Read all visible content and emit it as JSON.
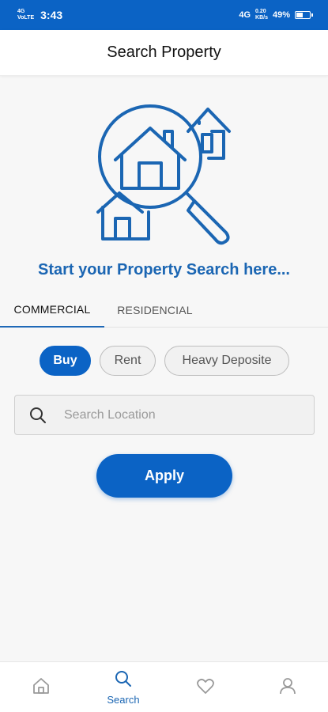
{
  "status_bar": {
    "network": "4G\nVoLTE",
    "time": "3:43",
    "signal_text": "4G",
    "speed": "0.20\nKB/s",
    "battery_percent": "49%",
    "battery_level": 0.49
  },
  "header": {
    "title": "Search Property"
  },
  "illustration": {
    "icon": "house-search-magnifier-icon",
    "color": "#1b66b3"
  },
  "headline": "Start your Property Search here...",
  "tabs": [
    {
      "label": "COMMERCIAL",
      "active": true
    },
    {
      "label": "RESIDENCIAL",
      "active": false
    }
  ],
  "chips": [
    {
      "label": "Buy",
      "active": true
    },
    {
      "label": "Rent",
      "active": false
    },
    {
      "label": "Heavy Deposite",
      "active": false
    }
  ],
  "search": {
    "placeholder": "Search Location",
    "value": ""
  },
  "apply_label": "Apply",
  "bottom_nav": [
    {
      "icon": "home-icon",
      "label": "",
      "active": false
    },
    {
      "icon": "search-icon",
      "label": "Search",
      "active": true
    },
    {
      "icon": "heart-icon",
      "label": "",
      "active": false
    },
    {
      "icon": "user-icon",
      "label": "",
      "active": false
    }
  ],
  "colors": {
    "primary": "#0b63c5",
    "text_accent": "#1b66b3",
    "inactive_icon": "#9a9a9a"
  }
}
